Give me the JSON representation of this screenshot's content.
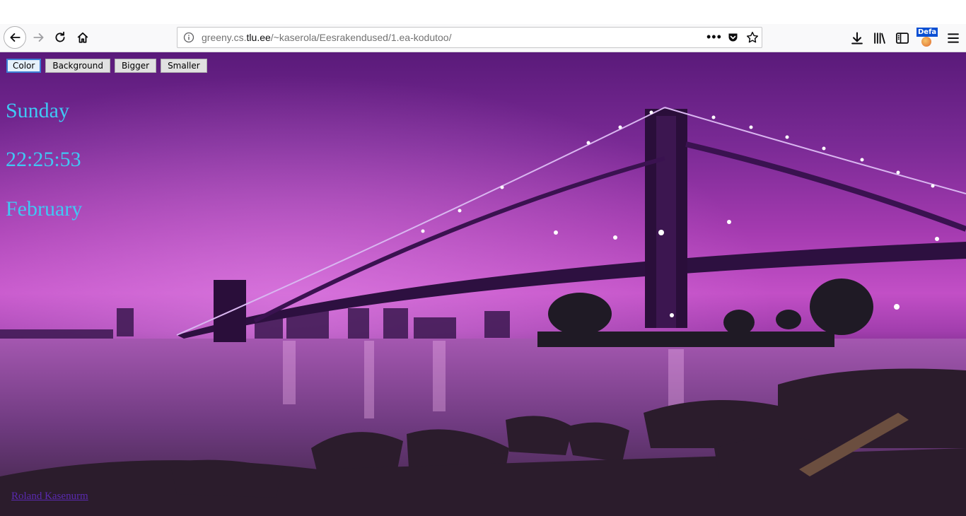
{
  "browser": {
    "url_prefix": "greeny.cs.",
    "url_host": "tlu.ee",
    "url_path": "/~kaserola/Eesrakendused/1.ea-kodutoo/",
    "page_actions": "•••",
    "extension_badge": "Defa",
    "icons": [
      "back-icon",
      "forward-icon",
      "reload-icon",
      "home-icon",
      "info-icon",
      "pocket-icon",
      "star-icon",
      "download-icon",
      "library-icon",
      "sidebar-icon",
      "menu-icon"
    ]
  },
  "page": {
    "buttons": {
      "color": "Color",
      "background": "Background",
      "bigger": "Bigger",
      "smaller": "Smaller"
    },
    "clock": {
      "day": "Sunday",
      "time": "22:25:53",
      "month": "February"
    },
    "author_link": "Roland Kasenurm",
    "text_color": "#40c8f4"
  }
}
